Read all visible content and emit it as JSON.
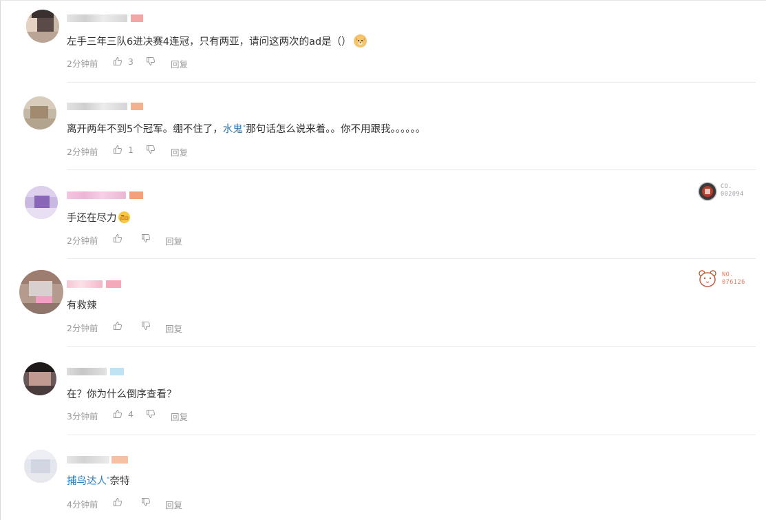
{
  "comments": [
    {
      "top": 0,
      "content_parts": [
        {
          "t": "text",
          "v": "左手三年三队6进决赛4连冠，只有两亚，请问这两次的ad是（）"
        }
      ],
      "emoji": "doge-emoji",
      "time": "2分钟前",
      "likes": "3",
      "reply": "回复"
    },
    {
      "content_parts": [
        {
          "t": "text",
          "v": "离开两年不到5个冠军。绷不住了，"
        },
        {
          "t": "mention",
          "v": "水鬼"
        },
        {
          "t": "text",
          "v": "那句话怎么说来着。。你不用跟我。。。。。。"
        }
      ],
      "time": "2分钟前",
      "likes": "1",
      "reply": "回复"
    },
    {
      "content_parts": [
        {
          "t": "text",
          "v": "手还在尽力"
        }
      ],
      "emoji": "facepalm-emoji",
      "time": "2分钟前",
      "likes": "",
      "reply": "回复",
      "medal": {
        "line1": "CO.",
        "line2": "002094",
        "color": "#9aa0a6"
      }
    },
    {
      "content_parts": [
        {
          "t": "text",
          "v": "有救辣"
        }
      ],
      "time": "2分钟前",
      "likes": "",
      "reply": "回复",
      "medal": {
        "line1": "NO.",
        "line2": "076126",
        "color": "#e27a5e"
      }
    },
    {
      "content_parts": [
        {
          "t": "text",
          "v": "在？你为什么倒序查看？"
        }
      ],
      "time": "3分钟前",
      "likes": "4",
      "reply": "回复"
    },
    {
      "content_parts": [
        {
          "t": "mention",
          "v": "捕鸟达人"
        },
        {
          "t": "text",
          "v": "奈特"
        }
      ],
      "time": "4分钟前",
      "likes": "",
      "reply": "回复"
    }
  ],
  "colors": {
    "mention": "#2b7ab8",
    "meta": "#999999",
    "divider": "#eaeaea"
  }
}
